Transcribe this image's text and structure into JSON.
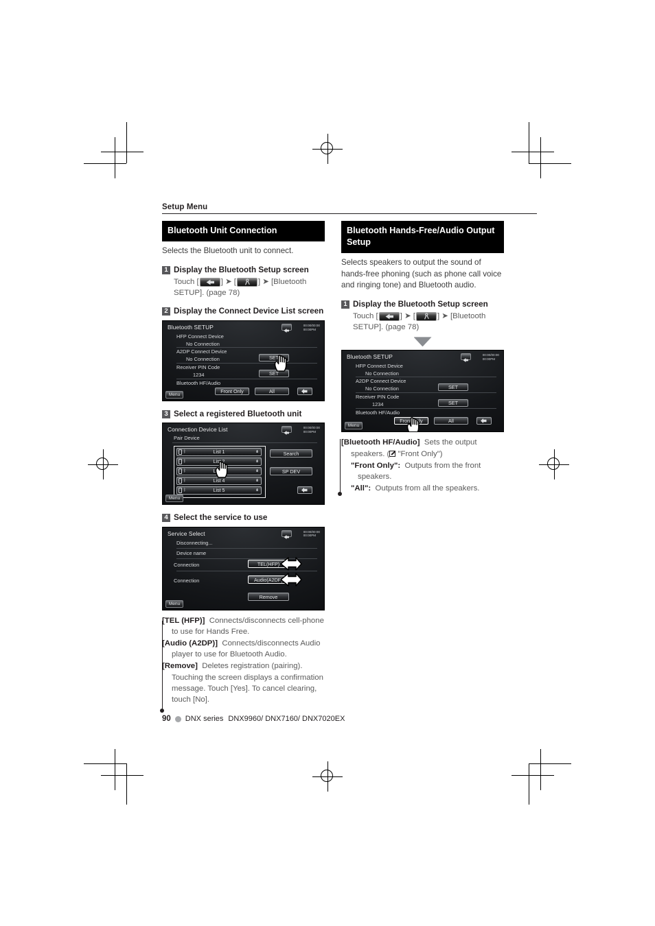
{
  "runhead": {
    "title": "Setup Menu"
  },
  "left": {
    "section_title": "Bluetooth Unit Connection",
    "lede": "Selects the Bluetooth unit to connect.",
    "steps": [
      {
        "num": "1",
        "title": "Display the Bluetooth Setup screen",
        "body_pre": "Touch [",
        "body_mid": "] ➤ [",
        "body_post": "] ➤ [Bluetooth SETUP]. (page 78)"
      },
      {
        "num": "2",
        "title": "Display the Connect Device List screen"
      },
      {
        "num": "3",
        "title": "Select a registered Bluetooth unit"
      },
      {
        "num": "4",
        "title": "Select the service to use"
      }
    ],
    "defs": [
      {
        "term": "[TEL (HFP)]",
        "desc": "Connects/disconnects cell-phone to use for Hands Free."
      },
      {
        "term": "[Audio (A2DP)]",
        "desc": "Connects/disconnects Audio player to use for Bluetooth Audio."
      },
      {
        "term": "[Remove]",
        "desc": "Deletes registration (pairing). Touching the screen displays a confirmation message. Touch [Yes]. To cancel clearing, touch [No]."
      }
    ]
  },
  "right": {
    "section_title": "Bluetooth Hands-Free/Audio Output Setup",
    "lede": "Selects speakers to output the sound of hands-free phoning (such as phone call voice and ringing tone) and Bluetooth audio.",
    "steps": [
      {
        "num": "1",
        "title": "Display the Bluetooth Setup screen",
        "body_pre": "Touch [",
        "body_mid": "] ➤ [",
        "body_post": "] ➤ [Bluetooth SETUP]. (page 78)"
      }
    ],
    "defs": [
      {
        "term": "[Bluetooth HF/Audio]",
        "desc": "Sets the output speakers. (",
        "desc2": " \"Front Only\")"
      },
      {
        "term": "\"Front Only\":",
        "desc": "Outputs from the front speakers."
      },
      {
        "term": "\"All\":",
        "desc": "Outputs from all the speakers."
      }
    ]
  },
  "screens": {
    "bt_setup": {
      "title": "Bluetooth SETUP",
      "clock_line1": "00:00/00:00",
      "clock_line2": "00:00PM",
      "rows": [
        "HFP Connect Device",
        "No Connection",
        "A2DP Connect Device",
        "No Connection",
        "Receiver PIN Code",
        "1234",
        "Bluetooth HF/Audio"
      ],
      "buttons": {
        "set1": "SET",
        "set2": "SET",
        "front_only": "Front Only",
        "all": "All"
      },
      "menu": "Menu"
    },
    "device_list": {
      "title": "Connection Device List",
      "subtitle": "Pair Device",
      "clock_line1": "00:00/00:00",
      "clock_line2": "00:00PM",
      "items": [
        "List 1",
        "List 2",
        "List 3",
        "List 4",
        "List 5"
      ],
      "buttons": {
        "search": "Search",
        "sp_dev": "SP DEV"
      },
      "menu": "Menu"
    },
    "service_select": {
      "title": "Service Select",
      "clock_line1": "00:00/00:00",
      "clock_line2": "00:00PM",
      "rows": [
        "Disconnecting...",
        "Device name",
        "Connection",
        "Connection"
      ],
      "buttons": {
        "tel": "TEL(HFP)",
        "audio": "Audio(A2DP)",
        "remove": "Remove"
      },
      "menu": "Menu"
    }
  },
  "footer": {
    "page": "90",
    "series": "DNX series",
    "models": "DNX9960/ DNX7160/ DNX7020EX"
  }
}
